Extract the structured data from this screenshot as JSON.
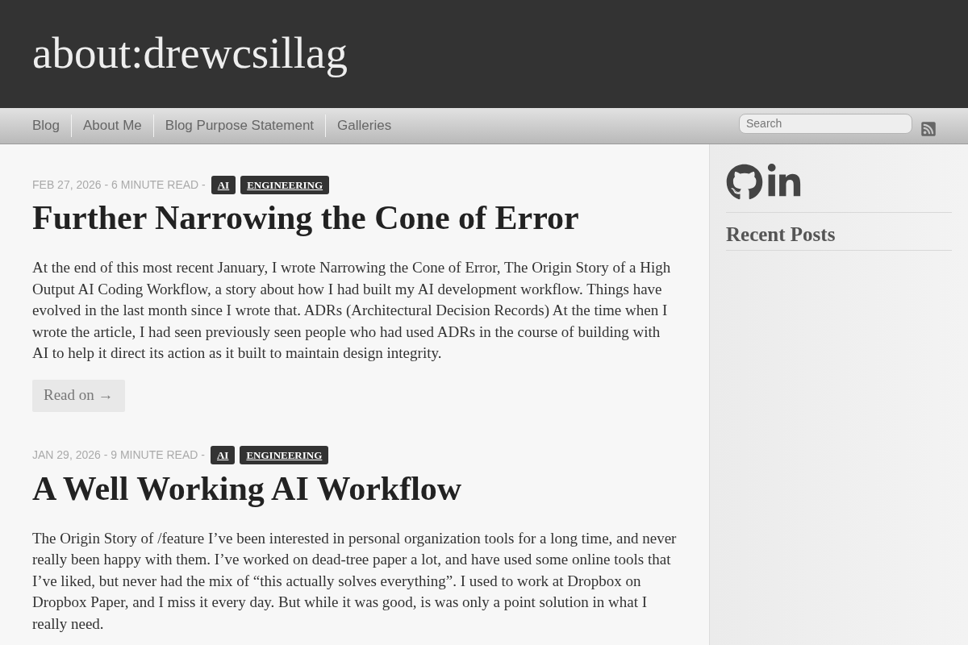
{
  "site": {
    "title": "about:drewcsillag"
  },
  "nav": {
    "items": [
      {
        "label": "Blog"
      },
      {
        "label": "About Me"
      },
      {
        "label": "Blog Purpose Statement"
      },
      {
        "label": "Galleries"
      }
    ],
    "search": {
      "placeholder": "Search"
    }
  },
  "posts": [
    {
      "meta": "FEB 27, 2026 - 6 MINUTE READ -",
      "tags": [
        "AI",
        "ENGINEERING"
      ],
      "title": "Further Narrowing the Cone of Error",
      "excerpt": "At the end of this most recent January, I wrote Narrowing the Cone of Error, The Origin Story of a High Output AI Coding Workflow, a story about how I had built my AI development workflow. Things have evolved in the last month since I wrote that. ADRs (Architectural Decision Records) At the time when I wrote the article, I had seen previously seen people who had used ADRs in the course of building with AI to help it direct its action as it built to maintain design integrity.",
      "read_more": "Read on →"
    },
    {
      "meta": "JAN 29, 2026 - 9 MINUTE READ -",
      "tags": [
        "AI",
        "ENGINEERING"
      ],
      "title": "A Well Working AI Workflow",
      "excerpt": "The Origin Story of /feature I’ve been interested in personal organization tools for a long time, and never really been happy with them. I’ve worked on dead-tree paper a lot, and have used some online tools that I’ve liked, but never had the mix of “this actually solves everything”. I used to work at Dropbox on Dropbox Paper, and I miss it every day. But while it was good, is was only a point solution in what I really need."
    }
  ],
  "sidebar": {
    "heading": "Recent Posts"
  }
}
